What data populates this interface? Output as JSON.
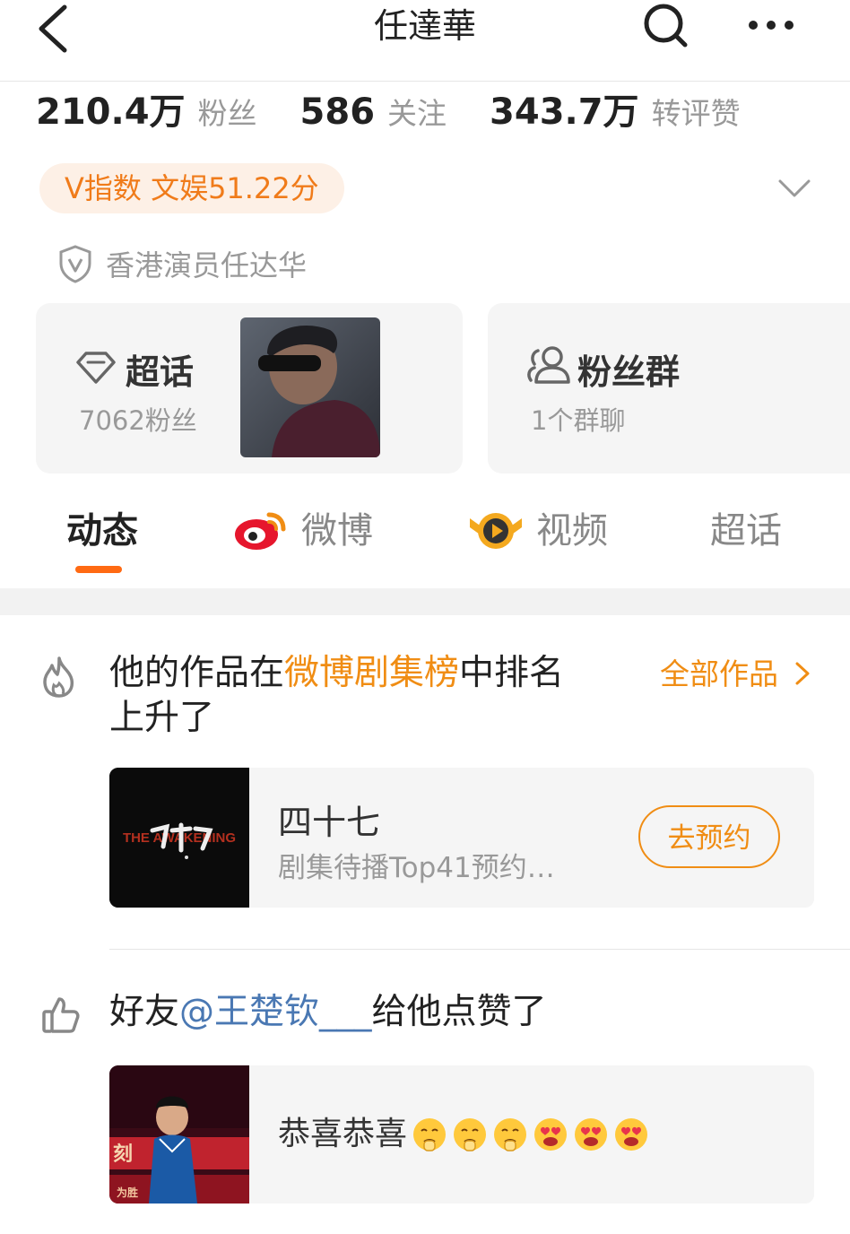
{
  "header": {
    "title": "任達華"
  },
  "stats": [
    {
      "num": "210.4万",
      "label": "粉丝"
    },
    {
      "num": "586",
      "label": "关注"
    },
    {
      "num": "343.7万",
      "label": "转评赞"
    }
  ],
  "vindex": "V指数 文娱51.22分",
  "verification": "香港演员任达华",
  "super_topic": {
    "title": "超话",
    "sub": "7062粉丝"
  },
  "fan_group": {
    "title": "粉丝群",
    "sub": "1个群聊"
  },
  "tabs": [
    "动态",
    "微博",
    "视频",
    "超话"
  ],
  "feed1": {
    "prefix": "他的作品在",
    "highlight": "微博剧集榜",
    "suffix": "中排名",
    "line2": "上升了",
    "all_works": "全部作品",
    "work_title": "四十七",
    "work_sub": "剧集待播Top41预约…",
    "reserve": "去预约",
    "poster_text": "THE AWAKENING"
  },
  "feed2": {
    "prefix": "好友",
    "mention": "@王楚钦___",
    "suffix": "给他点赞了",
    "comment": "恭喜恭喜"
  },
  "colors": {
    "accent": "#f08d14",
    "tab_indicator": "#ff6a13",
    "mention": "#4a78b3"
  }
}
